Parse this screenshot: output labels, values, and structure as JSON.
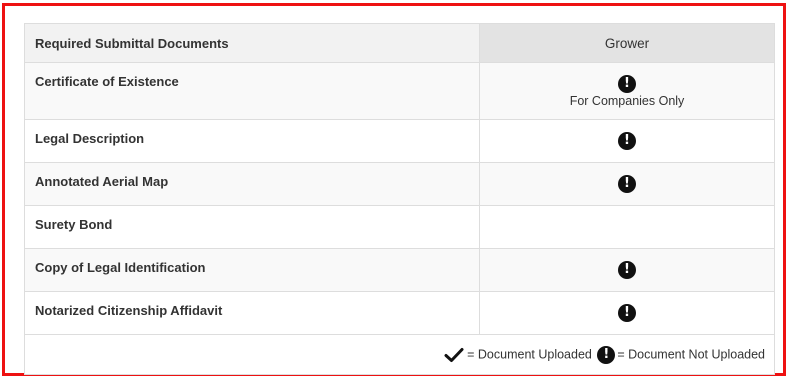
{
  "table": {
    "header": {
      "documents_col": "Required Submittal Documents",
      "grower_col": "Grower"
    },
    "rows": [
      {
        "label": "Certificate of Existence",
        "status_icon": "exclamation-circle-icon",
        "note": "For Companies Only"
      },
      {
        "label": "Legal Description",
        "status_icon": "exclamation-circle-icon"
      },
      {
        "label": "Annotated Aerial Map",
        "status_icon": "exclamation-circle-icon"
      },
      {
        "label": "Surety Bond",
        "status_icon": ""
      },
      {
        "label": "Copy of Legal Identification",
        "status_icon": "exclamation-circle-icon"
      },
      {
        "label": "Notarized Citizenship Affidavit",
        "status_icon": "exclamation-circle-icon"
      }
    ],
    "legend": {
      "uploaded_icon": "checkmark-icon",
      "uploaded_text": "= Document Uploaded",
      "not_uploaded_icon": "exclamation-circle-icon",
      "not_uploaded_text": "= Document Not Uploaded"
    }
  },
  "colors": {
    "frame_border": "#ee1111",
    "header_bg": "#f2f2f2",
    "grower_header_bg": "#e3e3e3",
    "icon": "#111111"
  }
}
